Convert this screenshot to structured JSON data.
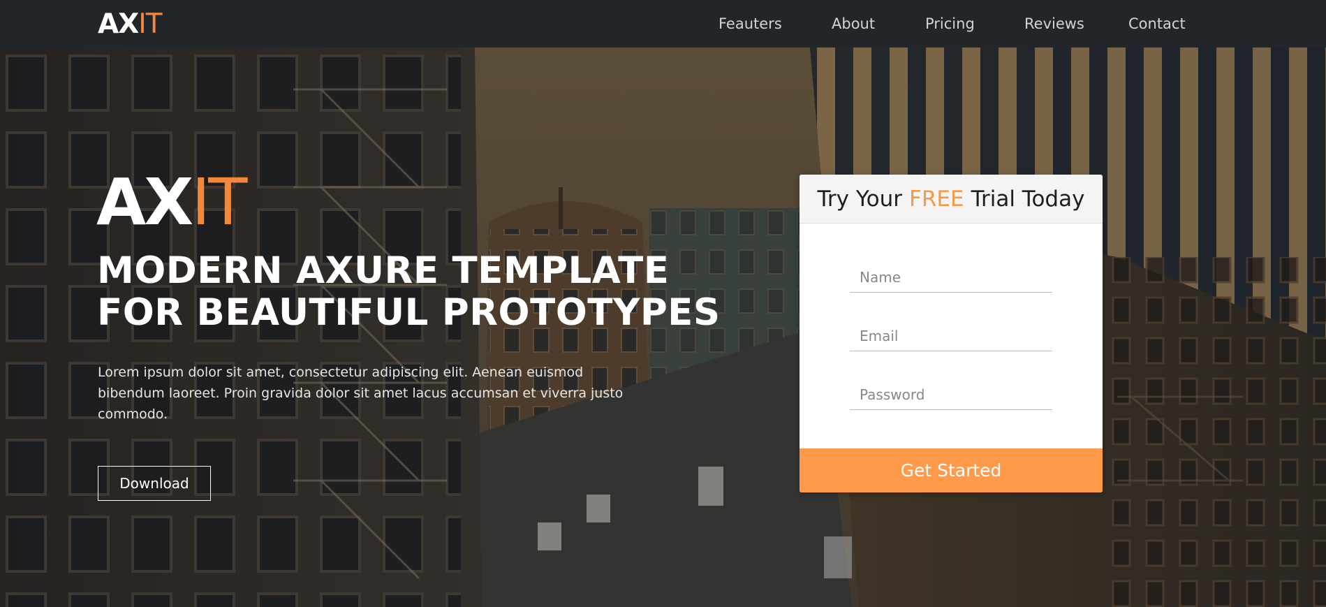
{
  "brand": {
    "logo_main": "AX",
    "logo_accent": "IT",
    "accent_color": "#f0883e"
  },
  "nav": {
    "items": [
      {
        "label": "Feauters"
      },
      {
        "label": "About"
      },
      {
        "label": "Pricing"
      },
      {
        "label": "Reviews"
      },
      {
        "label": "Contact"
      }
    ]
  },
  "hero": {
    "logo_main": "AX",
    "logo_accent": "IT",
    "title_line1": "MODERN AXURE TEMPLATE",
    "title_line2": "FOR BEAUTIFUL PROTOTYPES",
    "description": "Lorem ipsum dolor sit amet, consectetur adipiscing elit. Aenean euismod bibendum laoreet. Proin gravida dolor sit amet lacus accumsan et viverra justo commodo.",
    "download_label": "Download"
  },
  "signup": {
    "heading_prefix": "Try Your",
    "heading_highlight": "FREE",
    "heading_suffix": "Trial Today",
    "highlight_color": "#f59a49",
    "name_placeholder": "Name",
    "email_placeholder": "Email",
    "password_placeholder": "Password",
    "submit_label": "Get Started",
    "submit_color": "#ff9a4a"
  }
}
